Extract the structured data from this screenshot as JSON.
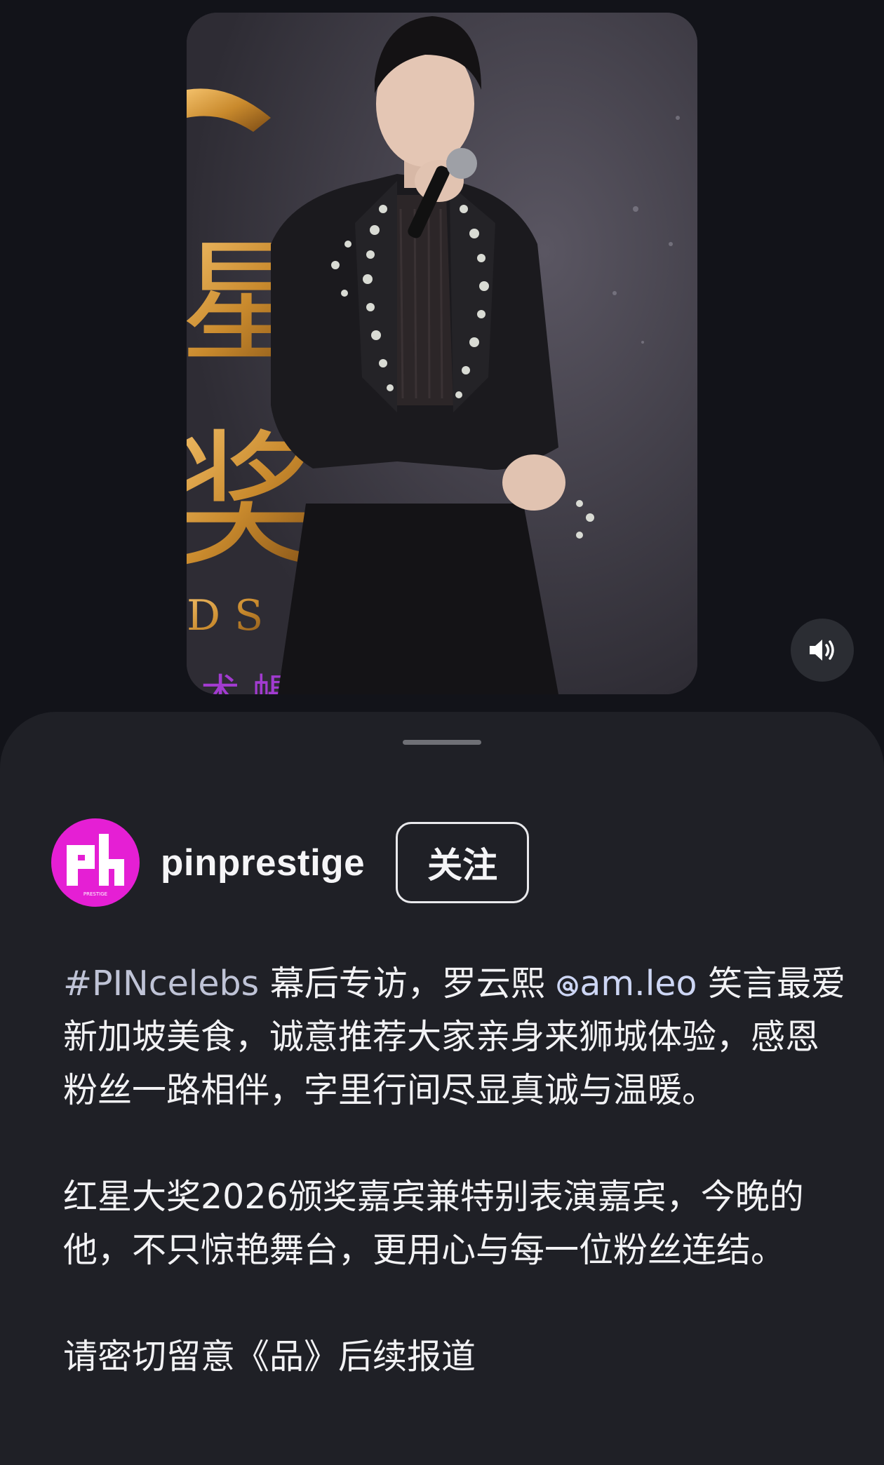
{
  "media": {
    "background_text_lines": [
      "星",
      "奖",
      "DS",
      "术 帳"
    ]
  },
  "post": {
    "author": {
      "username": "pinprestige",
      "avatar_text": "ph",
      "avatar_subtext": "PRESTIGE"
    },
    "follow_label": "关注",
    "caption": {
      "hashtag": "#PINcelebs",
      "part1": " 幕后专访，罗云熙 ",
      "mention_icon": "@",
      "mention": "am.leo",
      "part2": " 笑言最爱新加坡美食，诚意推荐大家亲身来狮城体验，感恩粉丝一路相伴，字里行间尽显真诚与温暖。",
      "paragraph2": "红星大奖2026颁奖嘉宾兼特别表演嘉宾，今晚的他，不只惊艳舞台，更用心与每一位粉丝连结。",
      "paragraph3": "请密切留意《品》后续报道"
    }
  },
  "colors": {
    "background": "#121319",
    "sheet": "#1f2026",
    "avatar": "#e51fd4",
    "hashtag": "#bfc3d6",
    "mention": "#cdd6f4"
  },
  "icons": {
    "sound": "speaker-volume-icon",
    "mention": "threads-at-icon"
  }
}
